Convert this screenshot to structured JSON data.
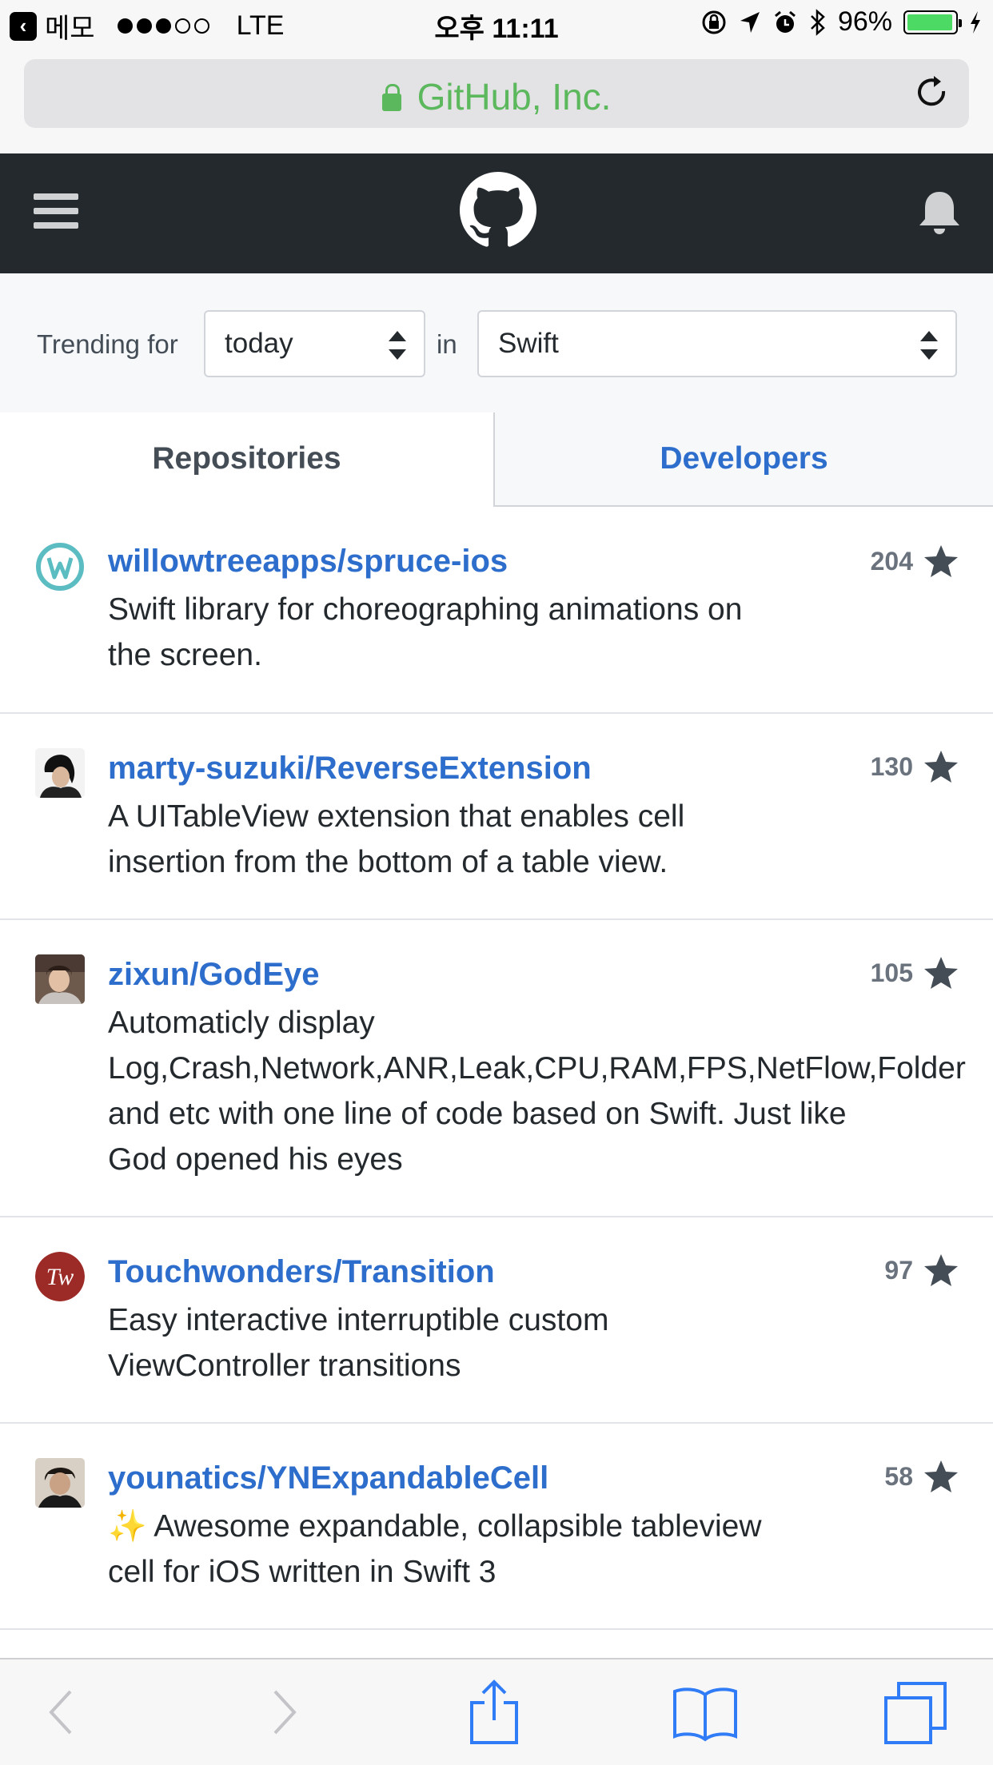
{
  "status_bar": {
    "back_app": "메모",
    "carrier": "LTE",
    "time": "오후 11:11",
    "battery": "96%",
    "battery_level": 0.96
  },
  "url_bar": {
    "site": "GitHub, Inc."
  },
  "header": {
    "icons": [
      "menu-icon",
      "github-logo-icon",
      "bell-icon"
    ]
  },
  "filter": {
    "trending_label": "Trending for",
    "period": "today",
    "in_label": "in",
    "language": "Swift"
  },
  "tabs": [
    {
      "label": "Repositories",
      "active": true
    },
    {
      "label": "Developers",
      "active": false
    }
  ],
  "repos": [
    {
      "name": "willowtreeapps/spruce-ios",
      "desc": [
        "Swift library for choreographing animations on",
        "the screen."
      ],
      "stars": "204"
    },
    {
      "name": "marty-suzuki/ReverseExtension",
      "desc": [
        "A UITableView extension that enables cell",
        "insertion from the bottom of a table view."
      ],
      "stars": "130"
    },
    {
      "name": "zixun/GodEye",
      "desc": [
        "Automaticly display",
        "Log,Crash,Network,ANR,Leak,CPU,RAM,FPS,NetFlow,Folder",
        "and etc with one line of code based on Swift. Just like",
        "God opened his eyes"
      ],
      "stars": "105"
    },
    {
      "name": "Touchwonders/Transition",
      "desc": [
        "Easy interactive interruptible custom",
        "ViewController transitions"
      ],
      "stars": "97"
    },
    {
      "name": "younatics/YNExpandableCell",
      "desc": [
        "✨ Awesome expandable, collapsible tableview",
        "cell for iOS written in Swift 3"
      ],
      "stars": "58"
    }
  ],
  "toolbar": {
    "icons": [
      "back-icon",
      "forward-icon",
      "share-icon",
      "bookmarks-icon",
      "tabs-icon"
    ]
  },
  "colors": {
    "link": "#2d6dcc",
    "header_bg": "#24292e",
    "url_green": "#5cb85c"
  }
}
